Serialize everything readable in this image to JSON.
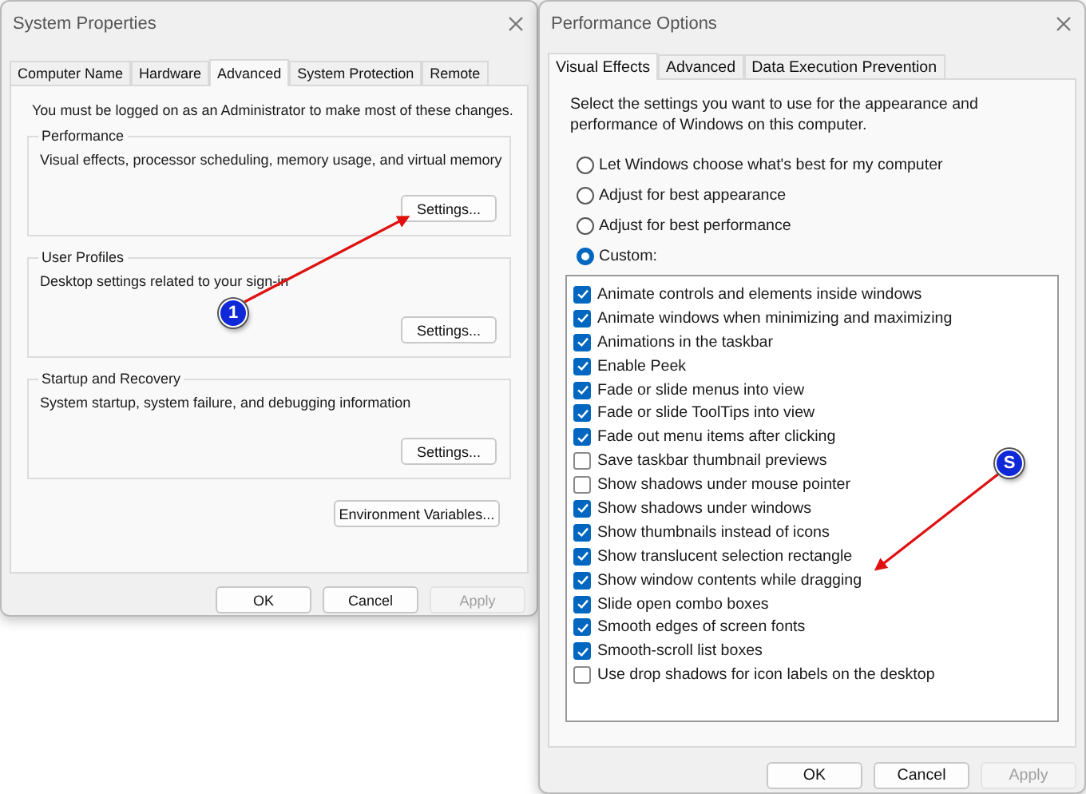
{
  "system_properties": {
    "title": "System Properties",
    "tabs": [
      {
        "label": "Computer Name",
        "selected": false
      },
      {
        "label": "Hardware",
        "selected": false
      },
      {
        "label": "Advanced",
        "selected": true
      },
      {
        "label": "System Protection",
        "selected": false
      },
      {
        "label": "Remote",
        "selected": false
      }
    ],
    "notice": "You must be logged on as an Administrator to make most of these changes.",
    "groups": [
      {
        "title": "Performance",
        "description": "Visual effects, processor scheduling, memory usage, and virtual memory",
        "button": "Settings..."
      },
      {
        "title": "User Profiles",
        "description": "Desktop settings related to your sign-in",
        "button": "Settings..."
      },
      {
        "title": "Startup and Recovery",
        "description": "System startup, system failure, and debugging information",
        "button": "Settings..."
      }
    ],
    "environment_button": "Environment Variables...",
    "buttons": [
      {
        "label": "OK",
        "disabled": false
      },
      {
        "label": "Cancel",
        "disabled": false
      },
      {
        "label": "Apply",
        "disabled": true
      }
    ]
  },
  "performance_options": {
    "title": "Performance Options",
    "tabs": [
      {
        "label": "Visual Effects",
        "selected": true
      },
      {
        "label": "Advanced",
        "selected": false
      },
      {
        "label": "Data Execution Prevention",
        "selected": false
      }
    ],
    "description": "Select the settings you want to use for the appearance and performance of Windows on this computer.",
    "options": [
      {
        "label": "Let Windows choose what's best for my computer",
        "selected": false
      },
      {
        "label": "Adjust for best appearance",
        "selected": false
      },
      {
        "label": "Adjust for best performance",
        "selected": false
      },
      {
        "label": "Custom:",
        "selected": true
      }
    ],
    "effects": [
      {
        "label": "Animate controls and elements inside windows",
        "checked": true
      },
      {
        "label": "Animate windows when minimizing and maximizing",
        "checked": true
      },
      {
        "label": "Animations in the taskbar",
        "checked": true
      },
      {
        "label": "Enable Peek",
        "checked": true
      },
      {
        "label": "Fade or slide menus into view",
        "checked": true
      },
      {
        "label": "Fade or slide ToolTips into view",
        "checked": true
      },
      {
        "label": "Fade out menu items after clicking",
        "checked": true
      },
      {
        "label": "Save taskbar thumbnail previews",
        "checked": false
      },
      {
        "label": "Show shadows under mouse pointer",
        "checked": false
      },
      {
        "label": "Show shadows under windows",
        "checked": true
      },
      {
        "label": "Show thumbnails instead of icons",
        "checked": true
      },
      {
        "label": "Show translucent selection rectangle",
        "checked": true
      },
      {
        "label": "Show window contents while dragging",
        "checked": true
      },
      {
        "label": "Slide open combo boxes",
        "checked": true
      },
      {
        "label": "Smooth edges of screen fonts",
        "checked": true
      },
      {
        "label": "Smooth-scroll list boxes",
        "checked": true
      },
      {
        "label": "Use drop shadows for icon labels on the desktop",
        "checked": false
      }
    ],
    "buttons": [
      {
        "label": "OK",
        "disabled": false
      },
      {
        "label": "Cancel",
        "disabled": false
      },
      {
        "label": "Apply",
        "disabled": true
      }
    ]
  },
  "annotations": [
    {
      "label": "1"
    },
    {
      "label": "S"
    }
  ]
}
